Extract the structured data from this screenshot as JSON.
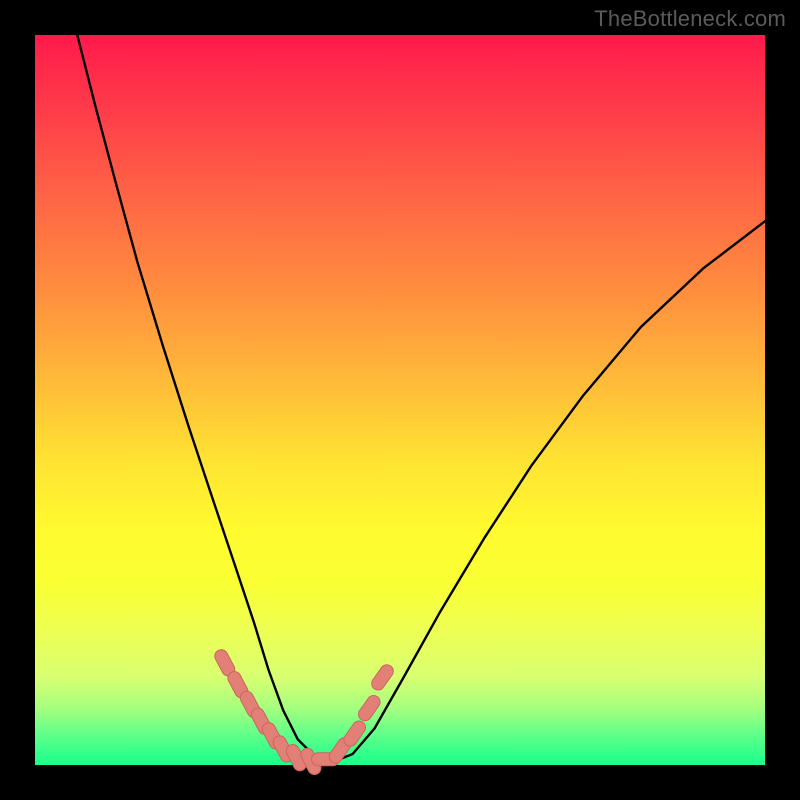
{
  "watermark": "TheBottleneck.com",
  "colors": {
    "frame": "#000000",
    "curve": "#000000",
    "marker_fill": "#e28077",
    "marker_stroke": "#c9665d",
    "gradient_stops": [
      "#ff1a4b",
      "#ff3b4a",
      "#ff6445",
      "#ff8a3f",
      "#ffb53a",
      "#ffe233",
      "#fffb2f",
      "#f9ff33",
      "#ecff56",
      "#d8ff72",
      "#a8ff7e",
      "#5dff8a",
      "#19ff8c"
    ]
  },
  "chart_data": {
    "type": "line",
    "title": "",
    "xlabel": "",
    "ylabel": "",
    "xlim": [
      0,
      1
    ],
    "ylim": [
      0,
      1
    ],
    "note": "Axes are unlabeled in the source image; x/y are normalized estimates read from pixel positions inside the 730×730 plot area (0,0 = bottom-left, 1,1 = top-right). The curve is a V-shaped dip with minimum near x≈0.35–0.40 at y≈0, left arm rising steeply to y≈1 at x≈0.06, right arm rising to y≈0.75 at x=1.",
    "series": [
      {
        "name": "curve",
        "x": [
          0.058,
          0.082,
          0.11,
          0.14,
          0.175,
          0.21,
          0.245,
          0.275,
          0.3,
          0.32,
          0.34,
          0.36,
          0.385,
          0.41,
          0.435,
          0.465,
          0.505,
          0.555,
          0.615,
          0.68,
          0.75,
          0.83,
          0.915,
          1.0
        ],
        "y": [
          1.0,
          0.905,
          0.8,
          0.69,
          0.575,
          0.465,
          0.36,
          0.27,
          0.195,
          0.13,
          0.075,
          0.035,
          0.01,
          0.005,
          0.015,
          0.05,
          0.12,
          0.21,
          0.31,
          0.41,
          0.505,
          0.6,
          0.68,
          0.745
        ]
      }
    ],
    "markers": {
      "name": "highlighted-points",
      "note": "Salmon-colored pill markers clustered near the minimum of the curve on both arms.",
      "x": [
        0.26,
        0.278,
        0.295,
        0.31,
        0.325,
        0.34,
        0.358,
        0.378,
        0.398,
        0.418,
        0.438,
        0.458,
        0.476
      ],
      "y": [
        0.14,
        0.11,
        0.083,
        0.06,
        0.04,
        0.022,
        0.01,
        0.005,
        0.008,
        0.02,
        0.043,
        0.078,
        0.12
      ]
    }
  }
}
